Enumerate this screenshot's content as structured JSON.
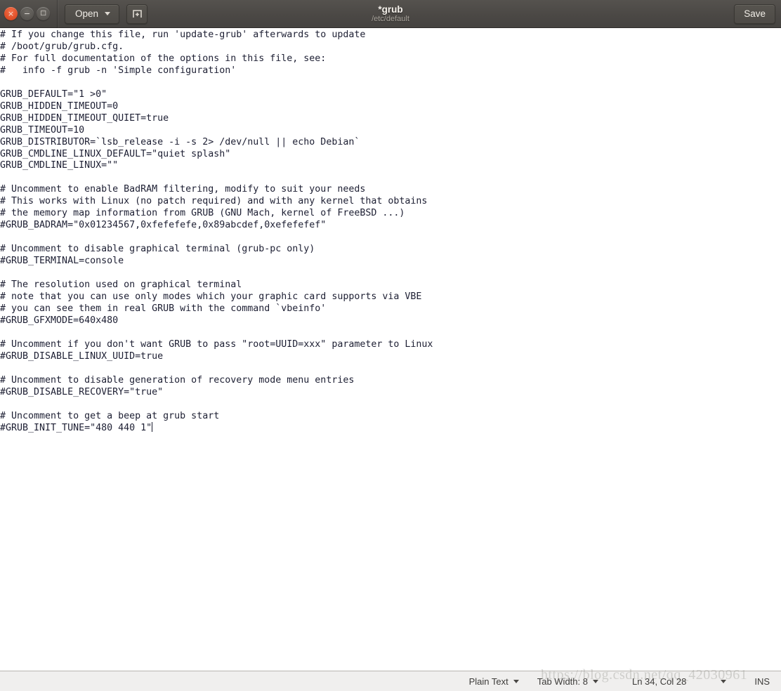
{
  "window": {
    "controls": {
      "close_label": "×",
      "minimize_label": "−",
      "maximize_label": "□"
    },
    "title": "*grub",
    "subtitle": "/etc/default"
  },
  "toolbar": {
    "open_label": "Open",
    "new_document_icon": "new-document-icon",
    "save_label": "Save"
  },
  "editor": {
    "language": "Plain Text",
    "content": "# If you change this file, run 'update-grub' afterwards to update\n# /boot/grub/grub.cfg.\n# For full documentation of the options in this file, see:\n#   info -f grub -n 'Simple configuration'\n\nGRUB_DEFAULT=\"1 >0\"\nGRUB_HIDDEN_TIMEOUT=0\nGRUB_HIDDEN_TIMEOUT_QUIET=true\nGRUB_TIMEOUT=10\nGRUB_DISTRIBUTOR=`lsb_release -i -s 2> /dev/null || echo Debian`\nGRUB_CMDLINE_LINUX_DEFAULT=\"quiet splash\"\nGRUB_CMDLINE_LINUX=\"\"\n\n# Uncomment to enable BadRAM filtering, modify to suit your needs\n# This works with Linux (no patch required) and with any kernel that obtains\n# the memory map information from GRUB (GNU Mach, kernel of FreeBSD ...)\n#GRUB_BADRAM=\"0x01234567,0xfefefefe,0x89abcdef,0xefefefef\"\n\n# Uncomment to disable graphical terminal (grub-pc only)\n#GRUB_TERMINAL=console\n\n# The resolution used on graphical terminal\n# note that you can use only modes which your graphic card supports via VBE\n# you can see them in real GRUB with the command `vbeinfo'\n#GRUB_GFXMODE=640x480\n\n# Uncomment if you don't want GRUB to pass \"root=UUID=xxx\" parameter to Linux\n#GRUB_DISABLE_LINUX_UUID=true\n\n# Uncomment to disable generation of recovery mode menu entries\n#GRUB_DISABLE_RECOVERY=\"true\"\n\n# Uncomment to get a beep at grub start\n#GRUB_INIT_TUNE=\"480 440 1\""
  },
  "statusbar": {
    "language_label": "Plain Text",
    "tab_width_label": "Tab Width: 8",
    "position_label": "Ln 34, Col 28",
    "insert_mode_label": "INS"
  },
  "watermark": {
    "text": "https://blog.csdn.net/qq_42030961"
  },
  "colors": {
    "titlebar_bg": "#4b4845",
    "close_button": "#e0512a",
    "editor_bg": "#ffffff",
    "editor_text": "#1d1f33",
    "statusbar_bg": "#f0efee"
  }
}
